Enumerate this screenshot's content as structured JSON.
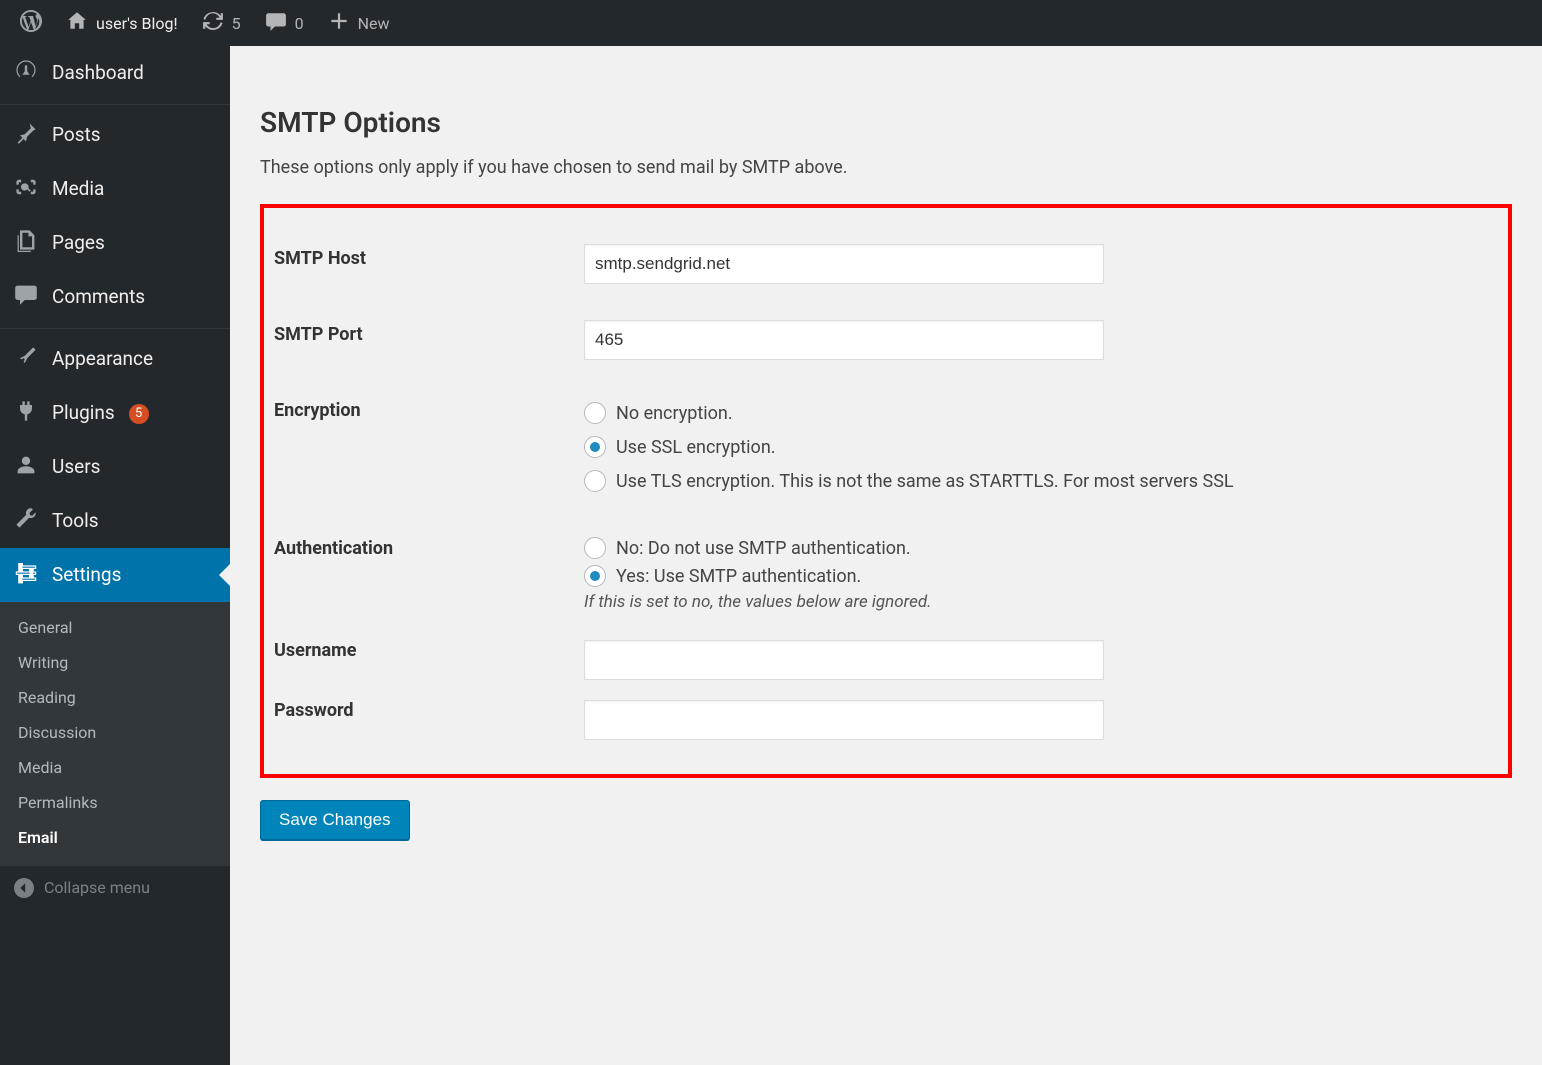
{
  "adminbar": {
    "site_title": "user's Blog!",
    "updates_count": "5",
    "comments_count": "0",
    "new_label": "New"
  },
  "sidebar": {
    "items": [
      {
        "id": "dashboard",
        "label": "Dashboard"
      },
      {
        "id": "posts",
        "label": "Posts"
      },
      {
        "id": "media",
        "label": "Media"
      },
      {
        "id": "pages",
        "label": "Pages"
      },
      {
        "id": "comments",
        "label": "Comments"
      },
      {
        "id": "appearance",
        "label": "Appearance"
      },
      {
        "id": "plugins",
        "label": "Plugins",
        "badge": "5"
      },
      {
        "id": "users",
        "label": "Users"
      },
      {
        "id": "tools",
        "label": "Tools"
      },
      {
        "id": "settings",
        "label": "Settings"
      }
    ],
    "submenu": [
      {
        "id": "general",
        "label": "General"
      },
      {
        "id": "writing",
        "label": "Writing"
      },
      {
        "id": "reading",
        "label": "Reading"
      },
      {
        "id": "discussion",
        "label": "Discussion"
      },
      {
        "id": "media_sub",
        "label": "Media"
      },
      {
        "id": "permalinks",
        "label": "Permalinks"
      },
      {
        "id": "email",
        "label": "Email"
      }
    ],
    "collapse_label": "Collapse menu"
  },
  "page": {
    "section_title": "SMTP Options",
    "section_desc": "These options only apply if you have chosen to send mail by SMTP above.",
    "fields": {
      "host": {
        "label": "SMTP Host",
        "value": "smtp.sendgrid.net"
      },
      "port": {
        "label": "SMTP Port",
        "value": "465"
      },
      "encryption": {
        "label": "Encryption",
        "options": {
          "none": "No encryption.",
          "ssl": "Use SSL encryption.",
          "tls": "Use TLS encryption. This is not the same as STARTTLS. For most servers SSL"
        },
        "selected": "ssl"
      },
      "auth": {
        "label": "Authentication",
        "options": {
          "no": "No: Do not use SMTP authentication.",
          "yes": "Yes: Use SMTP authentication."
        },
        "selected": "yes",
        "hint": "If this is set to no, the values below are ignored."
      },
      "username": {
        "label": "Username",
        "value": ""
      },
      "password": {
        "label": "Password",
        "value": ""
      }
    },
    "save_label": "Save Changes"
  }
}
